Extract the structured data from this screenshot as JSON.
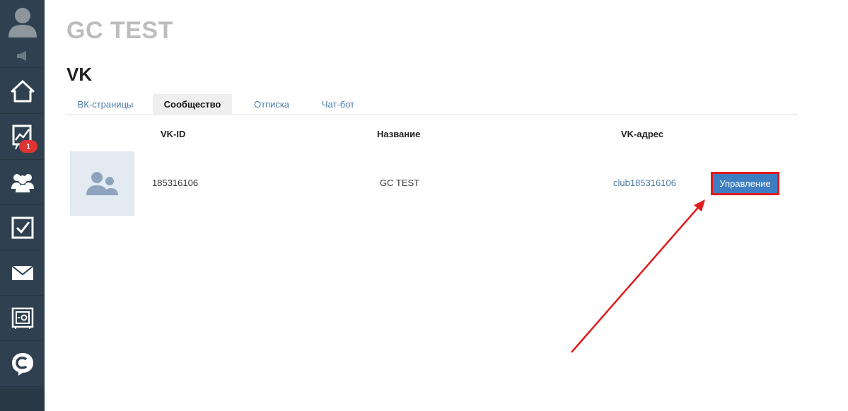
{
  "sidebar": {
    "icons": [
      "user-avatar-icon",
      "speaker-icon",
      "home-icon",
      "chart-icon",
      "users-icon",
      "tasks-icon",
      "mail-icon",
      "safe-icon",
      "chat-logo-icon"
    ],
    "chart_badge": "1",
    "colors": {
      "background": "#2f4050",
      "badge": "#dd3333"
    }
  },
  "header": {
    "app_title": "GC TEST",
    "section_title": "VK"
  },
  "tabs": [
    {
      "label": "ВК-страницы",
      "active": false
    },
    {
      "label": "Сообщество",
      "active": true
    },
    {
      "label": "Отписка",
      "active": false
    },
    {
      "label": "Чат-бот",
      "active": false
    }
  ],
  "table": {
    "headers": [
      "VK-ID",
      "Название",
      "VK-адрес"
    ],
    "rows": [
      {
        "avatar_icon": "group-icon",
        "vk_id": "185316106",
        "name": "GC TEST",
        "vk_address": "club185316106",
        "action_label": "Управление"
      }
    ]
  },
  "colors": {
    "accent": "#3d7ec2",
    "link": "#4a7aa8",
    "highlight": "#e21b1b"
  }
}
